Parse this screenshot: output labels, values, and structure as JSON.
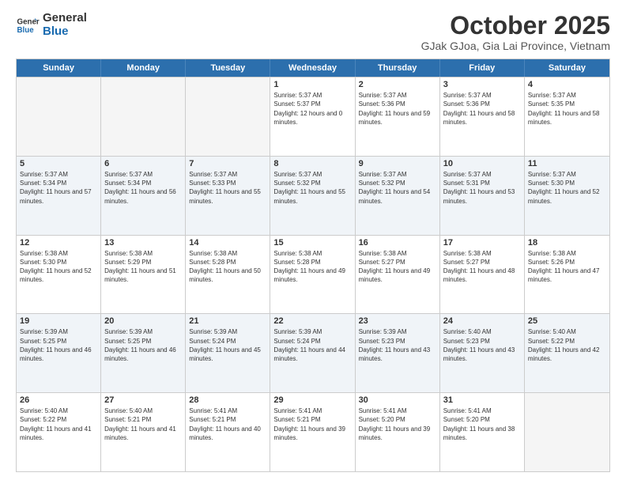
{
  "logo": {
    "line1": "General",
    "line2": "Blue"
  },
  "title": "October 2025",
  "subtitle": "GJak GJoa, Gia Lai Province, Vietnam",
  "days_of_week": [
    "Sunday",
    "Monday",
    "Tuesday",
    "Wednesday",
    "Thursday",
    "Friday",
    "Saturday"
  ],
  "weeks": [
    [
      {
        "day": "",
        "sunrise": "",
        "sunset": "",
        "daylight": "",
        "empty": true
      },
      {
        "day": "",
        "sunrise": "",
        "sunset": "",
        "daylight": "",
        "empty": true
      },
      {
        "day": "",
        "sunrise": "",
        "sunset": "",
        "daylight": "",
        "empty": true
      },
      {
        "day": "1",
        "sunrise": "Sunrise: 5:37 AM",
        "sunset": "Sunset: 5:37 PM",
        "daylight": "Daylight: 12 hours and 0 minutes.",
        "empty": false
      },
      {
        "day": "2",
        "sunrise": "Sunrise: 5:37 AM",
        "sunset": "Sunset: 5:36 PM",
        "daylight": "Daylight: 11 hours and 59 minutes.",
        "empty": false
      },
      {
        "day": "3",
        "sunrise": "Sunrise: 5:37 AM",
        "sunset": "Sunset: 5:36 PM",
        "daylight": "Daylight: 11 hours and 58 minutes.",
        "empty": false
      },
      {
        "day": "4",
        "sunrise": "Sunrise: 5:37 AM",
        "sunset": "Sunset: 5:35 PM",
        "daylight": "Daylight: 11 hours and 58 minutes.",
        "empty": false
      }
    ],
    [
      {
        "day": "5",
        "sunrise": "Sunrise: 5:37 AM",
        "sunset": "Sunset: 5:34 PM",
        "daylight": "Daylight: 11 hours and 57 minutes.",
        "empty": false
      },
      {
        "day": "6",
        "sunrise": "Sunrise: 5:37 AM",
        "sunset": "Sunset: 5:34 PM",
        "daylight": "Daylight: 11 hours and 56 minutes.",
        "empty": false
      },
      {
        "day": "7",
        "sunrise": "Sunrise: 5:37 AM",
        "sunset": "Sunset: 5:33 PM",
        "daylight": "Daylight: 11 hours and 55 minutes.",
        "empty": false
      },
      {
        "day": "8",
        "sunrise": "Sunrise: 5:37 AM",
        "sunset": "Sunset: 5:32 PM",
        "daylight": "Daylight: 11 hours and 55 minutes.",
        "empty": false
      },
      {
        "day": "9",
        "sunrise": "Sunrise: 5:37 AM",
        "sunset": "Sunset: 5:32 PM",
        "daylight": "Daylight: 11 hours and 54 minutes.",
        "empty": false
      },
      {
        "day": "10",
        "sunrise": "Sunrise: 5:37 AM",
        "sunset": "Sunset: 5:31 PM",
        "daylight": "Daylight: 11 hours and 53 minutes.",
        "empty": false
      },
      {
        "day": "11",
        "sunrise": "Sunrise: 5:37 AM",
        "sunset": "Sunset: 5:30 PM",
        "daylight": "Daylight: 11 hours and 52 minutes.",
        "empty": false
      }
    ],
    [
      {
        "day": "12",
        "sunrise": "Sunrise: 5:38 AM",
        "sunset": "Sunset: 5:30 PM",
        "daylight": "Daylight: 11 hours and 52 minutes.",
        "empty": false
      },
      {
        "day": "13",
        "sunrise": "Sunrise: 5:38 AM",
        "sunset": "Sunset: 5:29 PM",
        "daylight": "Daylight: 11 hours and 51 minutes.",
        "empty": false
      },
      {
        "day": "14",
        "sunrise": "Sunrise: 5:38 AM",
        "sunset": "Sunset: 5:28 PM",
        "daylight": "Daylight: 11 hours and 50 minutes.",
        "empty": false
      },
      {
        "day": "15",
        "sunrise": "Sunrise: 5:38 AM",
        "sunset": "Sunset: 5:28 PM",
        "daylight": "Daylight: 11 hours and 49 minutes.",
        "empty": false
      },
      {
        "day": "16",
        "sunrise": "Sunrise: 5:38 AM",
        "sunset": "Sunset: 5:27 PM",
        "daylight": "Daylight: 11 hours and 49 minutes.",
        "empty": false
      },
      {
        "day": "17",
        "sunrise": "Sunrise: 5:38 AM",
        "sunset": "Sunset: 5:27 PM",
        "daylight": "Daylight: 11 hours and 48 minutes.",
        "empty": false
      },
      {
        "day": "18",
        "sunrise": "Sunrise: 5:38 AM",
        "sunset": "Sunset: 5:26 PM",
        "daylight": "Daylight: 11 hours and 47 minutes.",
        "empty": false
      }
    ],
    [
      {
        "day": "19",
        "sunrise": "Sunrise: 5:39 AM",
        "sunset": "Sunset: 5:25 PM",
        "daylight": "Daylight: 11 hours and 46 minutes.",
        "empty": false
      },
      {
        "day": "20",
        "sunrise": "Sunrise: 5:39 AM",
        "sunset": "Sunset: 5:25 PM",
        "daylight": "Daylight: 11 hours and 46 minutes.",
        "empty": false
      },
      {
        "day": "21",
        "sunrise": "Sunrise: 5:39 AM",
        "sunset": "Sunset: 5:24 PM",
        "daylight": "Daylight: 11 hours and 45 minutes.",
        "empty": false
      },
      {
        "day": "22",
        "sunrise": "Sunrise: 5:39 AM",
        "sunset": "Sunset: 5:24 PM",
        "daylight": "Daylight: 11 hours and 44 minutes.",
        "empty": false
      },
      {
        "day": "23",
        "sunrise": "Sunrise: 5:39 AM",
        "sunset": "Sunset: 5:23 PM",
        "daylight": "Daylight: 11 hours and 43 minutes.",
        "empty": false
      },
      {
        "day": "24",
        "sunrise": "Sunrise: 5:40 AM",
        "sunset": "Sunset: 5:23 PM",
        "daylight": "Daylight: 11 hours and 43 minutes.",
        "empty": false
      },
      {
        "day": "25",
        "sunrise": "Sunrise: 5:40 AM",
        "sunset": "Sunset: 5:22 PM",
        "daylight": "Daylight: 11 hours and 42 minutes.",
        "empty": false
      }
    ],
    [
      {
        "day": "26",
        "sunrise": "Sunrise: 5:40 AM",
        "sunset": "Sunset: 5:22 PM",
        "daylight": "Daylight: 11 hours and 41 minutes.",
        "empty": false
      },
      {
        "day": "27",
        "sunrise": "Sunrise: 5:40 AM",
        "sunset": "Sunset: 5:21 PM",
        "daylight": "Daylight: 11 hours and 41 minutes.",
        "empty": false
      },
      {
        "day": "28",
        "sunrise": "Sunrise: 5:41 AM",
        "sunset": "Sunset: 5:21 PM",
        "daylight": "Daylight: 11 hours and 40 minutes.",
        "empty": false
      },
      {
        "day": "29",
        "sunrise": "Sunrise: 5:41 AM",
        "sunset": "Sunset: 5:21 PM",
        "daylight": "Daylight: 11 hours and 39 minutes.",
        "empty": false
      },
      {
        "day": "30",
        "sunrise": "Sunrise: 5:41 AM",
        "sunset": "Sunset: 5:20 PM",
        "daylight": "Daylight: 11 hours and 39 minutes.",
        "empty": false
      },
      {
        "day": "31",
        "sunrise": "Sunrise: 5:41 AM",
        "sunset": "Sunset: 5:20 PM",
        "daylight": "Daylight: 11 hours and 38 minutes.",
        "empty": false
      },
      {
        "day": "",
        "sunrise": "",
        "sunset": "",
        "daylight": "",
        "empty": true
      }
    ]
  ]
}
